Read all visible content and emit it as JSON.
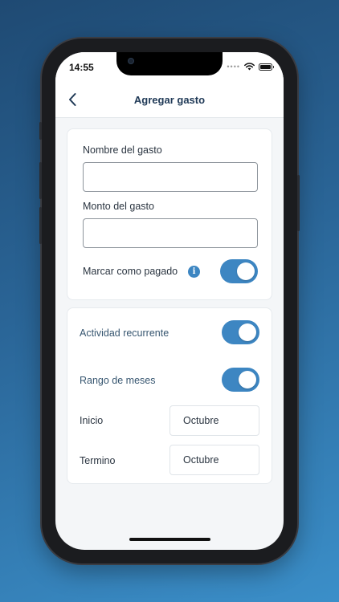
{
  "status_bar": {
    "time": "14:55",
    "signal_icon": "dots-signal-icon",
    "wifi_icon": "wifi-icon",
    "battery_icon": "battery-icon"
  },
  "nav": {
    "back_icon": "chevron-left-icon",
    "title": "Agregar gasto"
  },
  "expense_card": {
    "name_label": "Nombre del gasto",
    "name_value": "",
    "amount_label": "Monto del gasto",
    "amount_value": "",
    "paid_label": "Marcar como pagado",
    "paid_info_icon": "info-icon",
    "paid_on": true
  },
  "recurrence_card": {
    "recurring_label": "Actividad recurrente",
    "recurring_on": true,
    "range_label": "Rango de meses",
    "range_on": true,
    "start_label": "Inicio",
    "start_value": "Octubre",
    "end_label": "Termino",
    "end_value": "Octubre"
  },
  "colors": {
    "accent": "#3d86c2",
    "title": "#203a57",
    "background_gradient_top": "#1f4a73",
    "background_gradient_bottom": "#3b8fc9"
  }
}
